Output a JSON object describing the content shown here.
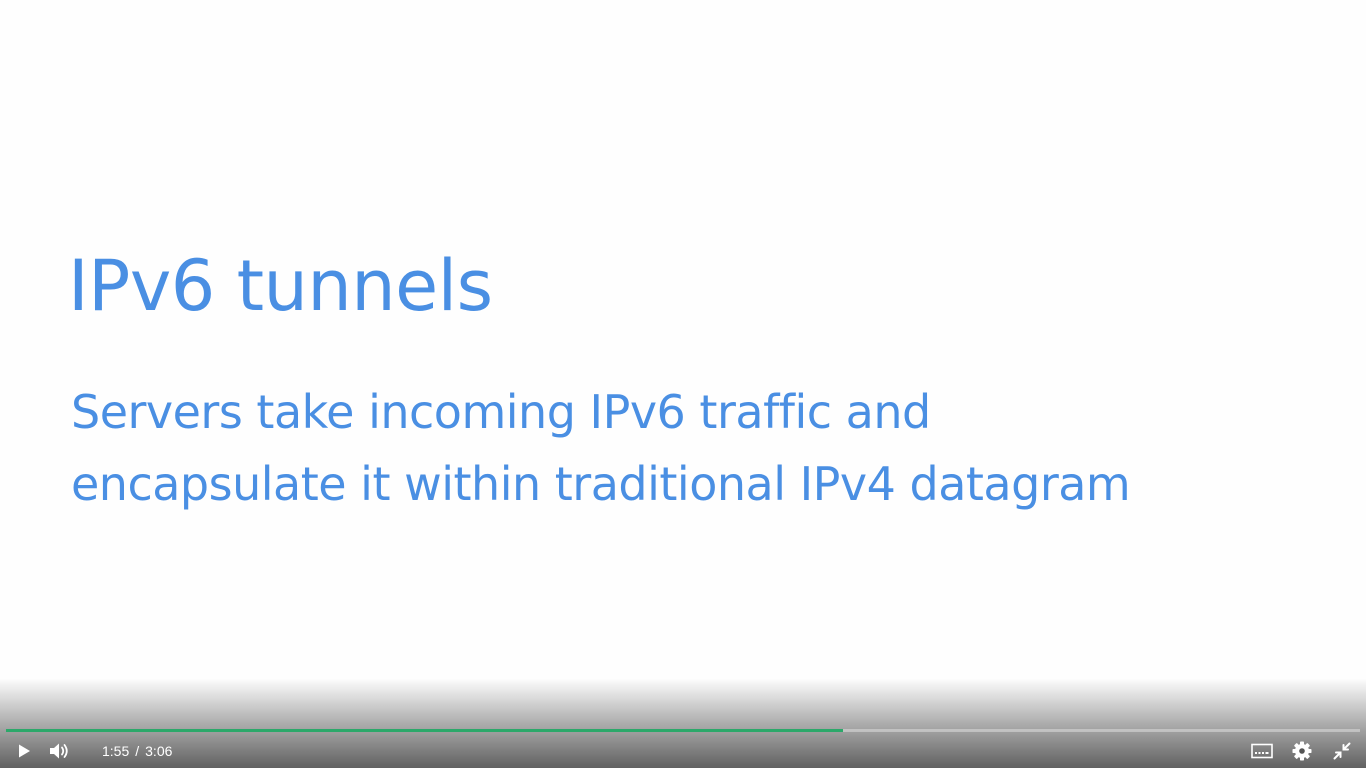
{
  "slide": {
    "title": "IPv6 tunnels",
    "body_line1": "Servers take incoming IPv6 traffic and",
    "body_line2": "encapsulate it within traditional IPv4 datagram"
  },
  "player": {
    "current_time": "1:55",
    "separator": "/",
    "duration": "3:06",
    "progress_fraction": 0.618,
    "icons": {
      "play": "play-icon",
      "volume": "volume-icon",
      "captions": "captions-icon",
      "settings": "gear-icon",
      "exit_fullscreen": "exit-fullscreen-icon"
    },
    "colors": {
      "progress": "#2ca86a",
      "text_accent": "#4a8fe3"
    }
  }
}
